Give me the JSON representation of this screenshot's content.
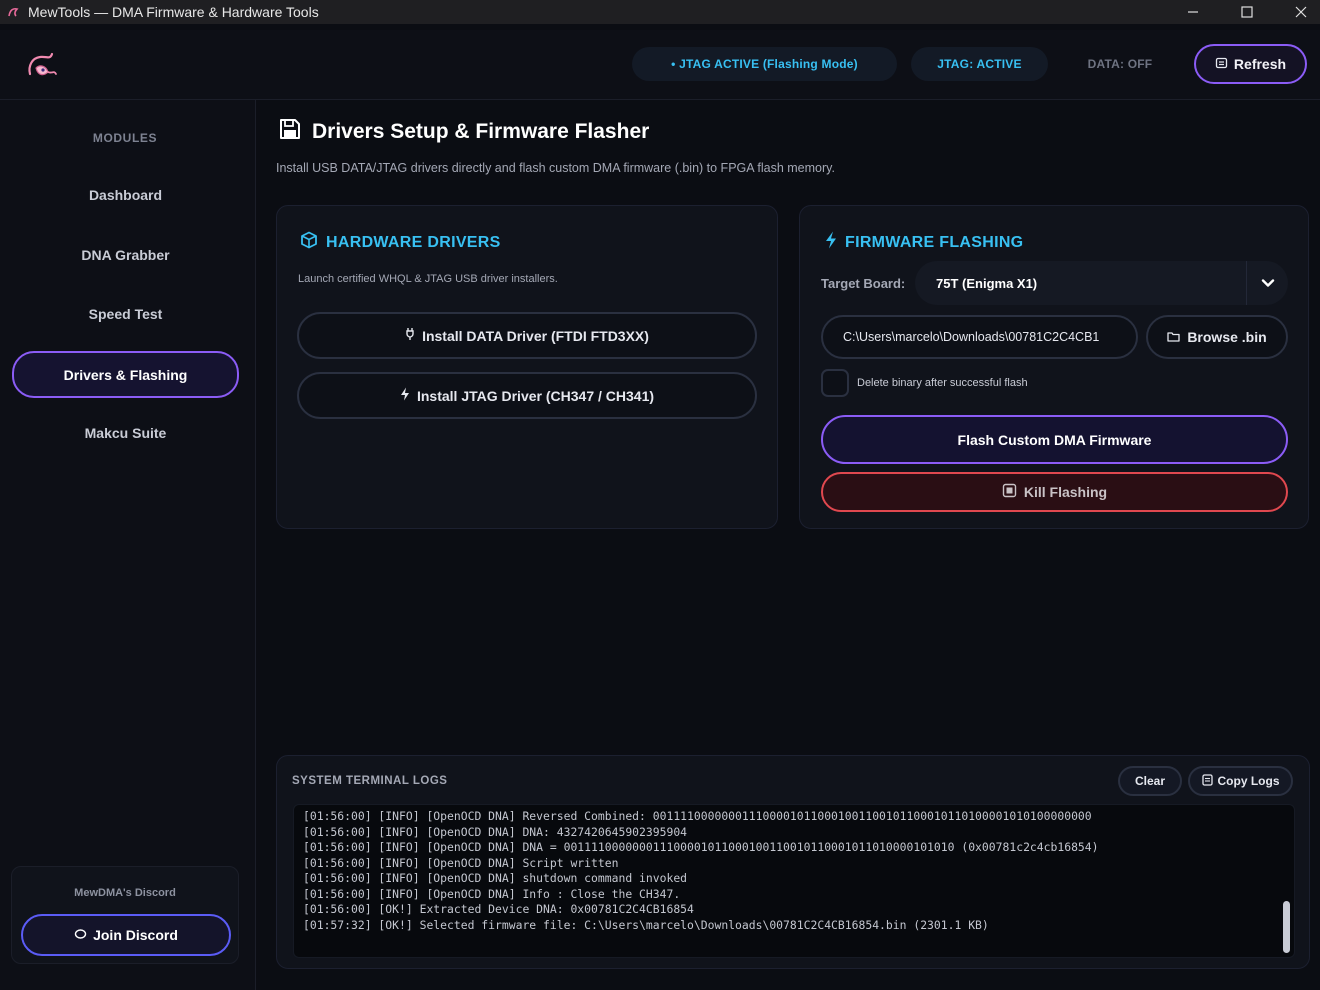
{
  "window": {
    "title": "MewTools — DMA Firmware & Hardware Tools"
  },
  "header": {
    "status_main": "• JTAG ACTIVE (Flashing Mode)",
    "status_jtag": "JTAG: ACTIVE",
    "status_data": "DATA: OFF",
    "refresh_label": "Refresh"
  },
  "sidebar": {
    "section_label": "MODULES",
    "items": [
      {
        "label": "Dashboard",
        "active": false
      },
      {
        "label": "DNA Grabber",
        "active": false
      },
      {
        "label": "Speed Test",
        "active": false
      },
      {
        "label": "Drivers & Flashing",
        "active": true
      },
      {
        "label": "Makcu Suite",
        "active": false
      }
    ],
    "discord": {
      "label": "MewDMA's Discord",
      "button": "Join Discord"
    }
  },
  "main": {
    "title": "Drivers Setup & Firmware Flasher",
    "subtitle": "Install USB DATA/JTAG drivers directly and flash custom DMA firmware (.bin) to FPGA flash memory."
  },
  "hardware_drivers": {
    "heading": "HARDWARE DRIVERS",
    "description": "Launch certified WHQL & JTAG USB driver installers.",
    "data_driver_button": "Install DATA Driver (FTDI FTD3XX)",
    "jtag_driver_button": "Install JTAG Driver (CH347 / CH341)"
  },
  "firmware_flashing": {
    "heading": "FIRMWARE FLASHING",
    "target_board_label": "Target Board:",
    "target_board_value": "75T (Enigma X1)",
    "file_path": "C:\\Users\\marcelo\\Downloads\\00781C2C4CB1",
    "browse_label": "Browse .bin",
    "delete_checkbox_label": "Delete binary after successful flash",
    "delete_checked": false,
    "flash_button": "Flash Custom DMA Firmware",
    "kill_button": "Kill Flashing"
  },
  "terminal": {
    "label": "SYSTEM TERMINAL LOGS",
    "clear_label": "Clear",
    "copy_label": "Copy Logs",
    "lines": [
      "[01:56:00] [INFO] [OpenOCD DNA] Reversed Combined: 0011110000000111000010110001001100101100010110100001010100000000",
      "[01:56:00] [INFO] [OpenOCD DNA] DNA: 4327420645902395904",
      "[01:56:00] [INFO] [OpenOCD DNA] DNA = 001111000000011100001011000100110010110001011010000101010 (0x00781c2c4cb16854)",
      "[01:56:00] [INFO] [OpenOCD DNA] Script written",
      "[01:56:00] [INFO] [OpenOCD DNA] shutdown command invoked",
      "[01:56:00] [INFO] [OpenOCD DNA] Info : Close the CH347.",
      "[01:56:00] [OK!] Extracted Device DNA: 0x00781C2C4CB16854",
      "[01:57:32] [OK!] Selected firmware file: C:\\Users\\marcelo\\Downloads\\00781C2C4CB16854.bin (2301.1 KB)"
    ]
  },
  "colors": {
    "accent_purple": "#8b5cf6",
    "accent_cyan": "#38c0f2",
    "danger_red": "#e0484f",
    "background": "#0b0d13"
  },
  "icons": {
    "app": "mew-logo-icon",
    "refresh": "refresh-icon",
    "page_title": "floppy-disk-icon",
    "hardware": "cube-icon",
    "firmware": "lightning-icon",
    "data_driver": "usb-plug-icon",
    "jtag_driver": "lightning-icon",
    "browse": "folder-icon",
    "kill": "chip-icon",
    "discord": "discord-icon",
    "copy": "clipboard-icon",
    "dropdown": "chevron-down-icon"
  }
}
